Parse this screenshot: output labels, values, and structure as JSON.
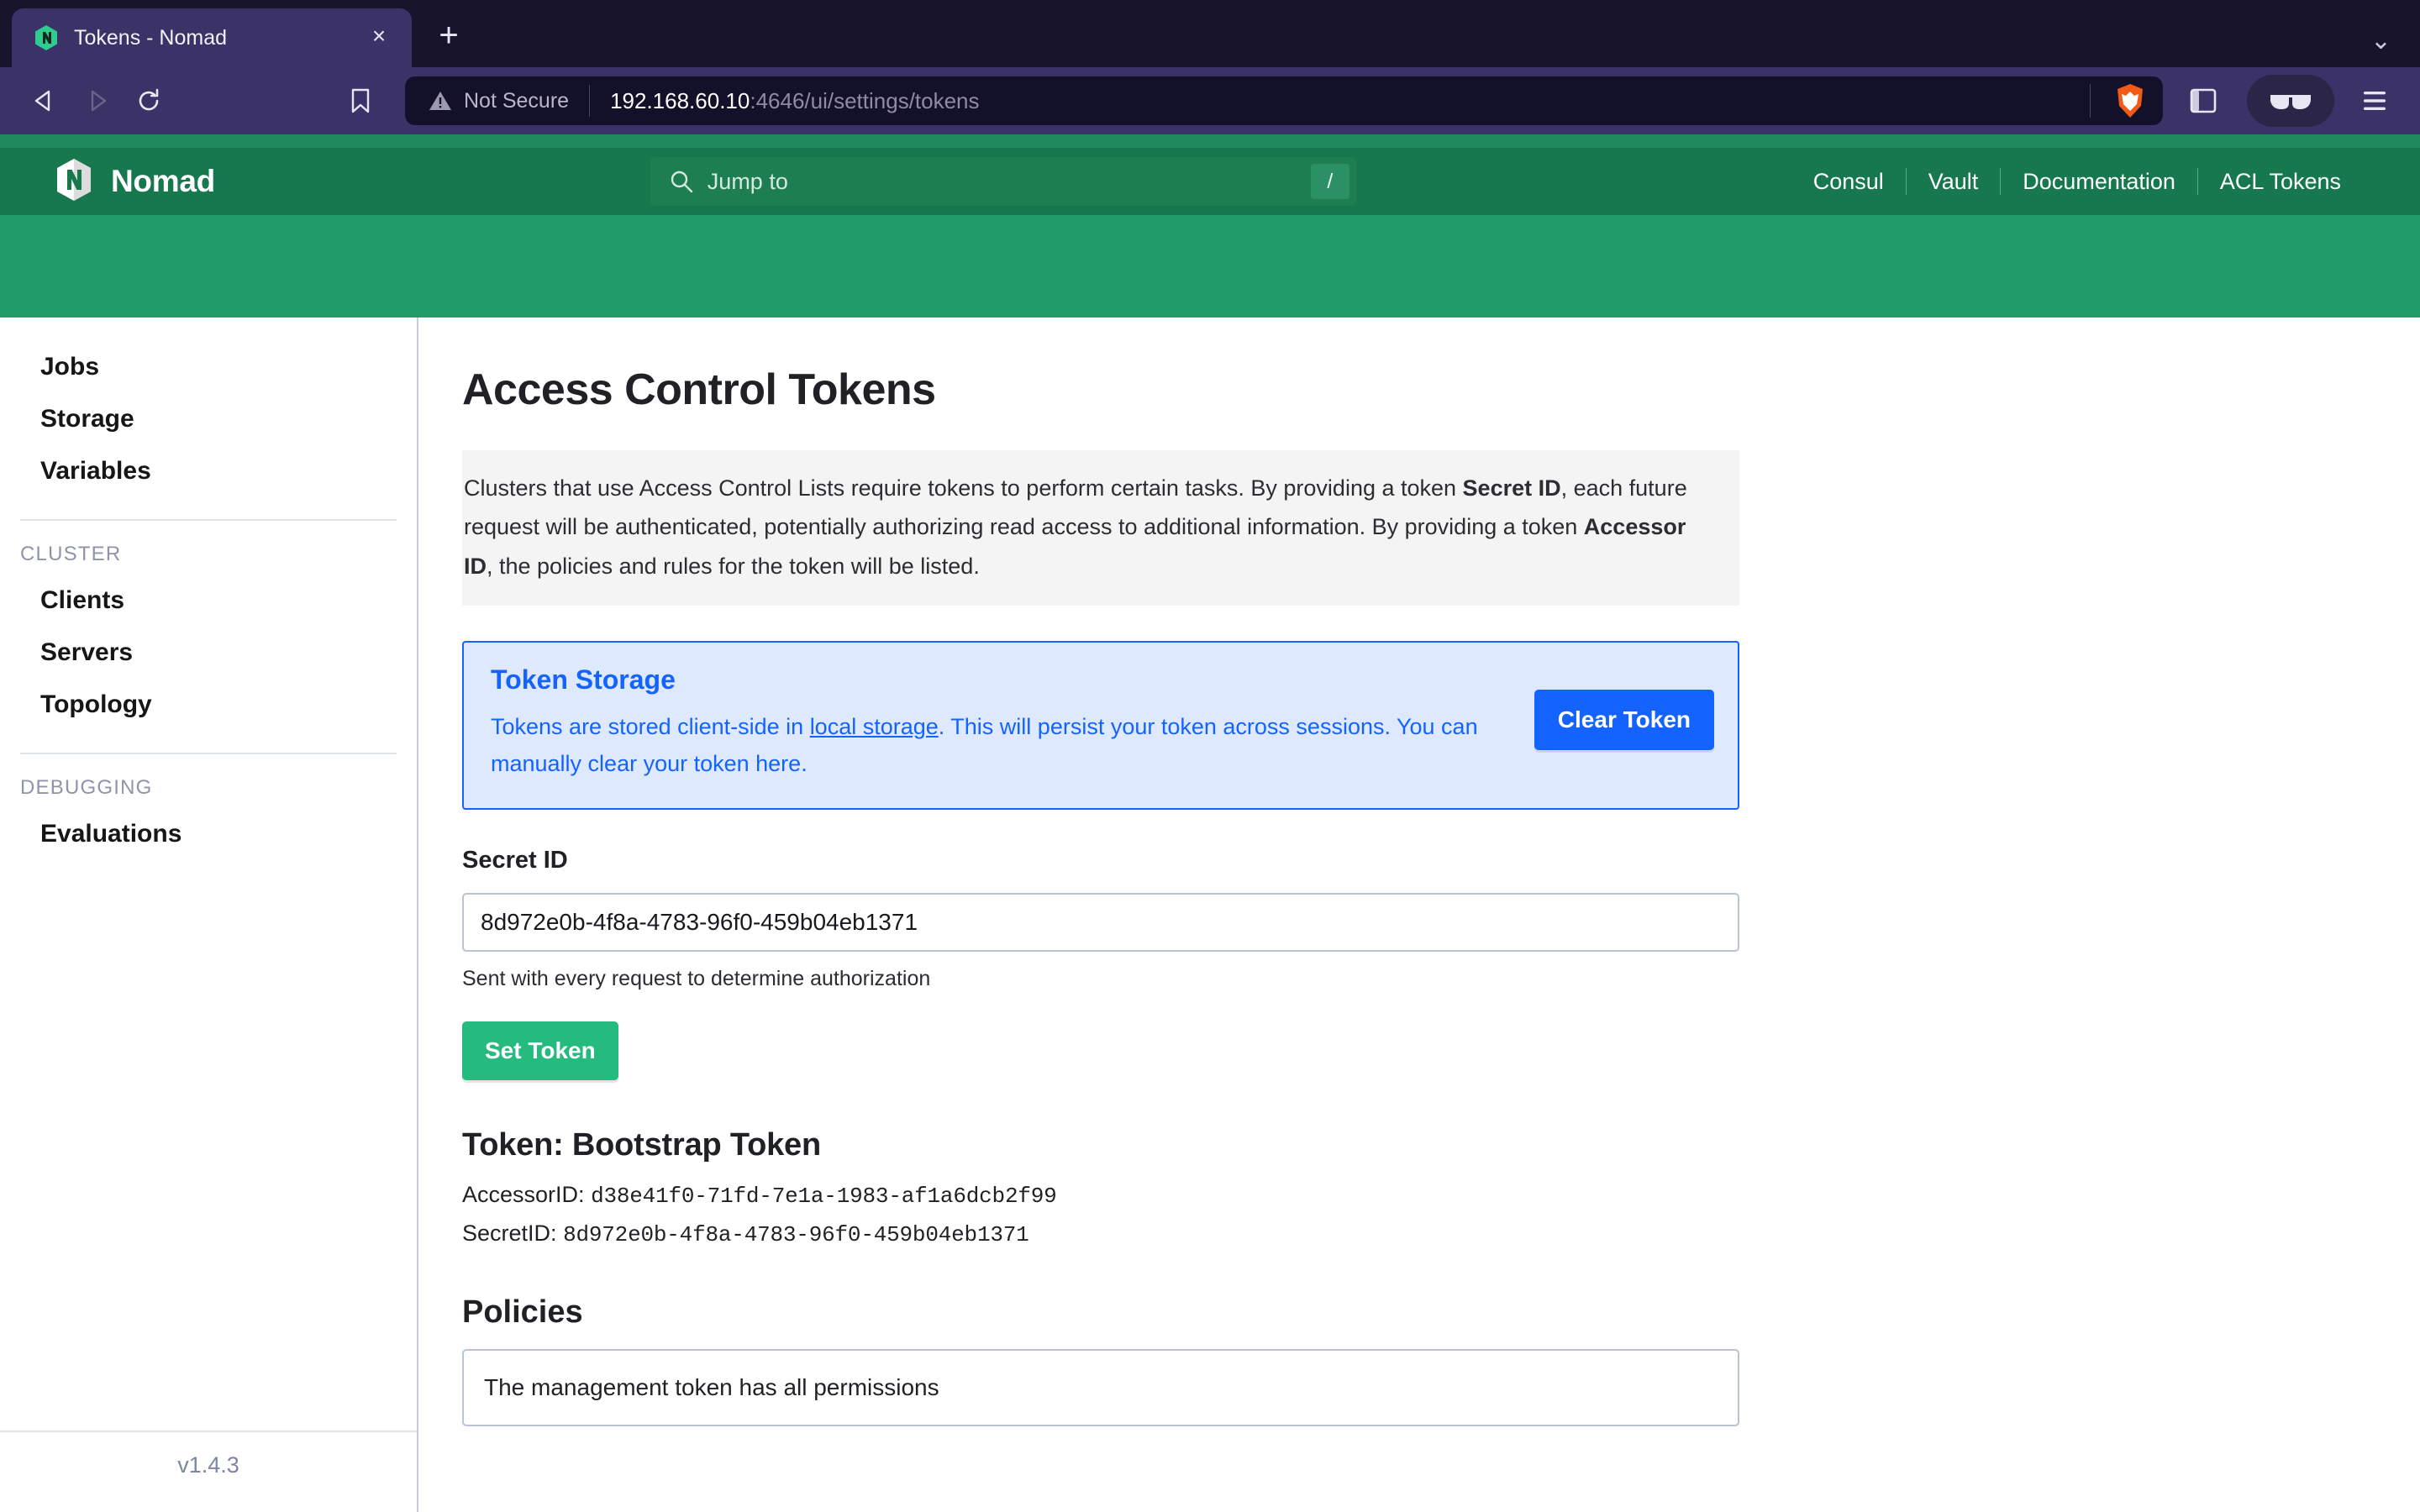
{
  "browser": {
    "tab": {
      "title": "Tokens - Nomad",
      "favicon": "nomad-logo-icon",
      "close_label": "×"
    },
    "newtab_label": "+",
    "tablist_chevron": "⌄",
    "back_label": "◀",
    "forward_label": "▶",
    "reload_label": "⟳",
    "security": {
      "text": "Not Secure",
      "icon": "warning-triangle-icon"
    },
    "url": {
      "host": "192.168.60.10",
      "rest": ":4646/ui/settings/tokens"
    }
  },
  "navbar": {
    "brand": "Nomad",
    "search": {
      "placeholder": "Jump to",
      "shortcut": "/"
    },
    "links": [
      {
        "label": "Consul"
      },
      {
        "label": "Vault"
      },
      {
        "label": "Documentation"
      },
      {
        "label": "ACL Tokens"
      }
    ]
  },
  "sidebar": {
    "top_items": [
      {
        "label": "Jobs"
      },
      {
        "label": "Storage"
      },
      {
        "label": "Variables"
      }
    ],
    "cluster_heading": "Cluster",
    "cluster_items": [
      {
        "label": "Clients"
      },
      {
        "label": "Servers"
      },
      {
        "label": "Topology"
      }
    ],
    "debugging_heading": "Debugging",
    "debugging_items": [
      {
        "label": "Evaluations"
      }
    ],
    "version": "v1.4.3"
  },
  "main": {
    "title": "Access Control Tokens",
    "description": {
      "part1": "Clusters that use Access Control Lists require tokens to perform certain tasks. By providing a token ",
      "bold1": "Secret ID",
      "part2": ", each future request will be authenticated, potentially authorizing read access to additional information. By providing a token ",
      "bold2": "Accessor ID",
      "part3": ", the policies and rules for the token will be listed."
    },
    "alert": {
      "title": "Token Storage",
      "text_before_link": "Tokens are stored client-side in ",
      "link_text": "local storage",
      "text_after_link": ". This will persist your token across sessions. You can manually clear your token here.",
      "button_label": "Clear Token"
    },
    "secret_id": {
      "label": "Secret ID",
      "value": "8d972e0b-4f8a-4783-96f0-459b04eb1371",
      "help": "Sent with every request to determine authorization",
      "submit_label": "Set Token"
    },
    "token": {
      "heading": "Token: Bootstrap Token",
      "accessor_label": "AccessorID:",
      "accessor_value": "d38e41f0-71fd-7e1a-1983-af1a6dcb2f99",
      "secret_label": "SecretID:",
      "secret_value": "8d972e0b-4f8a-4783-96f0-459b04eb1371"
    },
    "policies": {
      "heading": "Policies",
      "body": "The management token has all permissions"
    }
  },
  "colors": {
    "nomad_green": "#17784d",
    "nomad_green_light": "#219b68",
    "accent_blue": "#1563ff",
    "accent_green": "#25ba7e",
    "browser_purple": "#3b3268"
  }
}
